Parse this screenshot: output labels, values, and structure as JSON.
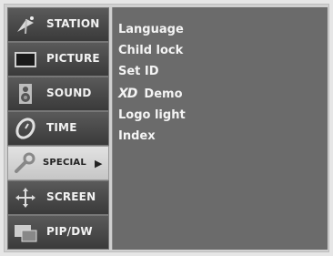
{
  "sidebar": {
    "items": [
      {
        "label": "STATION",
        "icon": "antenna-icon"
      },
      {
        "label": "PICTURE",
        "icon": "tv-screen-icon"
      },
      {
        "label": "SOUND",
        "icon": "speaker-icon"
      },
      {
        "label": "TIME",
        "icon": "clock-icon"
      },
      {
        "label": "SPECIAL",
        "icon": "wrench-icon",
        "active": true,
        "arrow": "▶"
      },
      {
        "label": "SCREEN",
        "icon": "move-cross-icon"
      },
      {
        "label": "PIP/DW",
        "icon": "pip-icon"
      }
    ]
  },
  "menu": {
    "items": [
      {
        "label": "Language"
      },
      {
        "label": "Child lock"
      },
      {
        "label": "Set ID"
      },
      {
        "logo": "XD",
        "label": "Demo"
      },
      {
        "label": "Logo light"
      },
      {
        "label": "Index"
      }
    ]
  }
}
